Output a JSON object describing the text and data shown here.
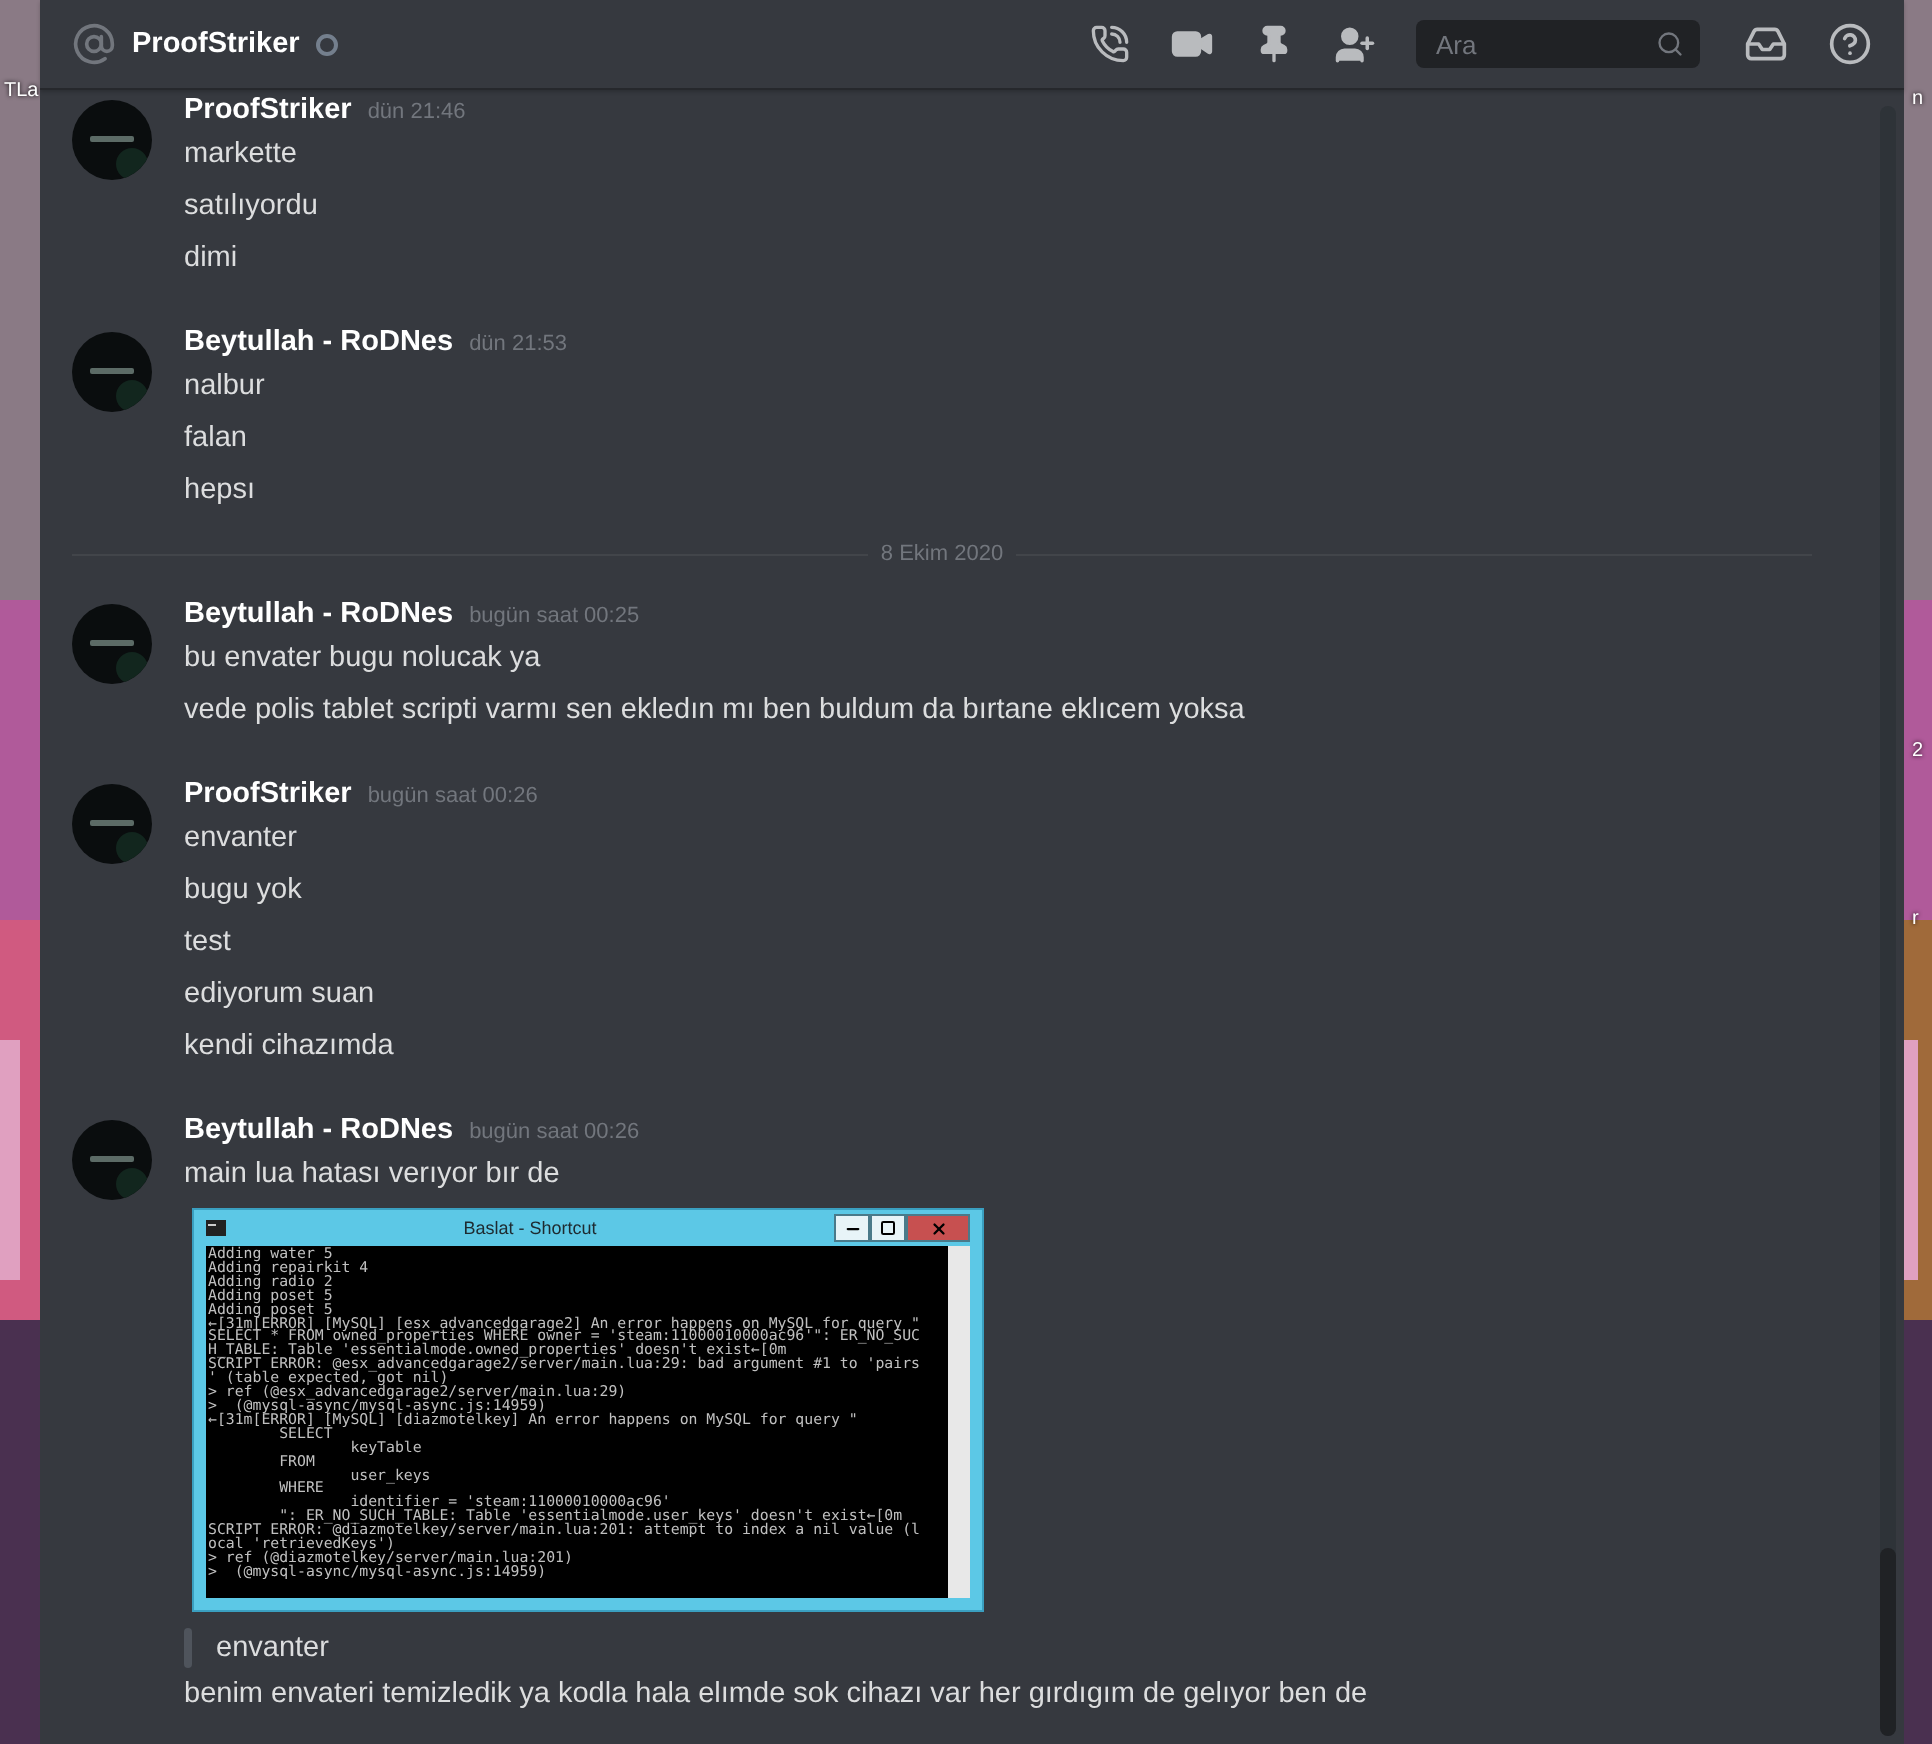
{
  "desktop": {
    "left_text": "TLa",
    "right_texts": [
      "n",
      "2",
      "r"
    ]
  },
  "header": {
    "channel": "ProofStriker",
    "online": false,
    "search": {
      "placeholder": "Ara"
    }
  },
  "messages": [
    {
      "kind": "group",
      "author": "ProofStriker",
      "timestamp": "dün 21:46",
      "items": [
        {
          "kind": "text",
          "text": "markette"
        },
        {
          "kind": "text",
          "text": "satılıyordu"
        },
        {
          "kind": "text",
          "text": "dimi"
        }
      ]
    },
    {
      "kind": "group",
      "author": "Beytullah - RoDNes",
      "timestamp": "dün 21:53",
      "items": [
        {
          "kind": "text",
          "text": "nalbur"
        },
        {
          "kind": "text",
          "text": "falan"
        },
        {
          "kind": "text",
          "text": "hepsı"
        }
      ]
    },
    {
      "kind": "divider",
      "label": "8 Ekim 2020"
    },
    {
      "kind": "group",
      "author": "Beytullah - RoDNes",
      "timestamp": "bugün saat 00:25",
      "items": [
        {
          "kind": "text",
          "text": "bu envater bugu nolucak ya"
        },
        {
          "kind": "text",
          "text": "vede polis tablet scripti varmı sen ekledın mı ben buldum da bırtane eklıcem yoksa"
        }
      ]
    },
    {
      "kind": "group",
      "author": "ProofStriker",
      "timestamp": "bugün saat 00:26",
      "items": [
        {
          "kind": "text",
          "text": "envanter"
        },
        {
          "kind": "text",
          "text": "bugu yok"
        },
        {
          "kind": "text",
          "text": "test"
        },
        {
          "kind": "text",
          "text": "ediyorum suan"
        },
        {
          "kind": "text",
          "text": "kendi cihazımda"
        }
      ]
    },
    {
      "kind": "group",
      "author": "Beytullah - RoDNes",
      "timestamp": "bugün saat 00:26",
      "items": [
        {
          "kind": "text",
          "text": "main lua hatası verıyor bır de"
        },
        {
          "kind": "console",
          "title": "Baslat - Shortcut",
          "lines": [
            "Adding water 5",
            "Adding repairkit 4",
            "Adding radio 2",
            "Adding poset 5",
            "Adding poset 5",
            "←[31m[ERROR] [MySQL] [esx_advancedgarage2] An error happens on MySQL for query \"",
            "SELECT * FROM owned_properties WHERE owner = 'steam:11000010000ac96'\": ER_NO_SUC",
            "H_TABLE: Table 'essentialmode.owned_properties' doesn't exist←[0m",
            "SCRIPT ERROR: @esx_advancedgarage2/server/main.lua:29: bad argument #1 to 'pairs",
            "' (table expected, got nil)",
            "> ref (@esx_advancedgarage2/server/main.lua:29)",
            ">  (@mysql-async/mysql-async.js:14959)",
            "←[31m[ERROR] [MySQL] [diazmotelkey] An error happens on MySQL for query \"",
            "        SELECT",
            "                keyTable",
            "        FROM",
            "                user_keys",
            "        WHERE",
            "                identifier = 'steam:11000010000ac96'",
            "        \": ER_NO_SUCH_TABLE: Table 'essentialmode.user_keys' doesn't exist←[0m",
            "SCRIPT ERROR: @diazmotelkey/server/main.lua:201: attempt to index a nil value (l",
            "ocal 'retrievedKeys')",
            "> ref (@diazmotelkey/server/main.lua:201)",
            ">  (@mysql-async/mysql-async.js:14959)"
          ]
        },
        {
          "kind": "quote",
          "text": "envanter"
        },
        {
          "kind": "text",
          "text": "benim envateri temizledik ya kodla hala elımde sok cihazı var her gırdıgım de gelıyor ben de"
        }
      ]
    }
  ]
}
